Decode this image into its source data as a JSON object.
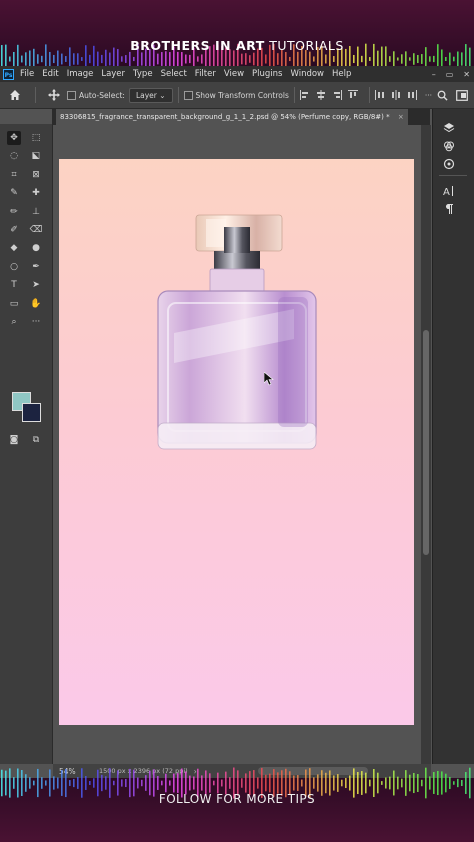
{
  "brand": {
    "bold": "BROTHERS IN ART",
    "light": "TUTORIALS"
  },
  "footer": {
    "cta": "FOLLOW FOR MORE TIPS"
  },
  "app": {
    "logo": "Ps",
    "menu": [
      "File",
      "Edit",
      "Image",
      "Layer",
      "Type",
      "Select",
      "Filter",
      "View",
      "Plugins",
      "Window",
      "Help"
    ],
    "window_controls": [
      "–",
      "▭",
      "✕"
    ]
  },
  "options": {
    "auto_select_label": "Auto-Select:",
    "layer_select_value": "Layer",
    "transform_label": "Show Transform Controls"
  },
  "document_tab": {
    "title": "83306815_fragrance_transparent_background_g_1_1_2.psd @ 54% (Perfume copy, RGB/8#) *",
    "close": "×"
  },
  "status": {
    "zoom": "54%",
    "doc_size": "1500 px x 2396 px (72 ppi)"
  },
  "colors": {
    "foreground": "#8fc7c4",
    "background": "#1c2340",
    "canvas_top": "#fcd3c3",
    "canvas_bottom": "#fbc9e9",
    "accent": "#31a8ff"
  },
  "icons": {
    "tools": [
      "move-icon",
      "marquee-icon",
      "lasso-icon",
      "object-select-icon",
      "crop-icon",
      "frame-icon",
      "eyedropper-icon",
      "spot-heal-icon",
      "brush-icon",
      "stamp-icon",
      "history-brush-icon",
      "eraser-icon",
      "gradient-icon",
      "blur-icon",
      "dodge-icon",
      "pen-icon",
      "type-icon",
      "path-select-icon",
      "rectangle-icon",
      "hand-icon",
      "zoom-icon",
      "more-icon"
    ],
    "right_panel": [
      "layers-icon",
      "channels-icon",
      "paths-icon",
      "character-icon",
      "paragraph-icon"
    ]
  }
}
